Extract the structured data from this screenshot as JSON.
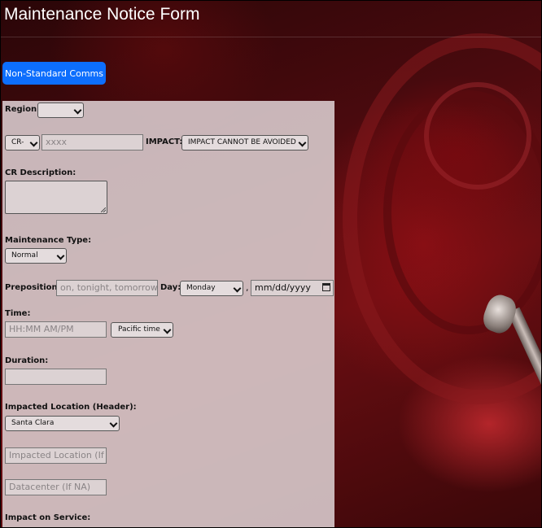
{
  "page": {
    "title": "Maintenance Notice Form"
  },
  "buttons": {
    "non_standard_comms": "Non-Standard Comms"
  },
  "form": {
    "region": {
      "label": "Region",
      "colon": ":",
      "value": ""
    },
    "cr": {
      "prefix_value": "CR-",
      "number_placeholder": "xxxx"
    },
    "impact": {
      "label": "IMPACT:",
      "value": "IMPACT CANNOT BE AVOIDED"
    },
    "cr_description": {
      "label": "CR Description:"
    },
    "maintenance_type": {
      "label": "Maintenance Type:",
      "value": "Normal"
    },
    "preposition": {
      "label": "Preposition:",
      "placeholder": "on, tonight, tomorrow, e"
    },
    "day": {
      "label": "Day:",
      "value": "Monday",
      "separator": ",",
      "date_placeholder": "mm/dd/yyyy"
    },
    "time": {
      "label": "Time:",
      "placeholder": "HH:MM AM/PM",
      "timezone": "Pacific time"
    },
    "duration": {
      "label": "Duration:"
    },
    "impacted_location": {
      "label": "Impacted Location (Header):",
      "value": "Santa Clara",
      "other_placeholder": "Impacted Location (If NA",
      "datacenter_placeholder": "Datacenter (If NA)"
    },
    "impact_on_service": {
      "label": "Impact on Service:"
    }
  }
}
